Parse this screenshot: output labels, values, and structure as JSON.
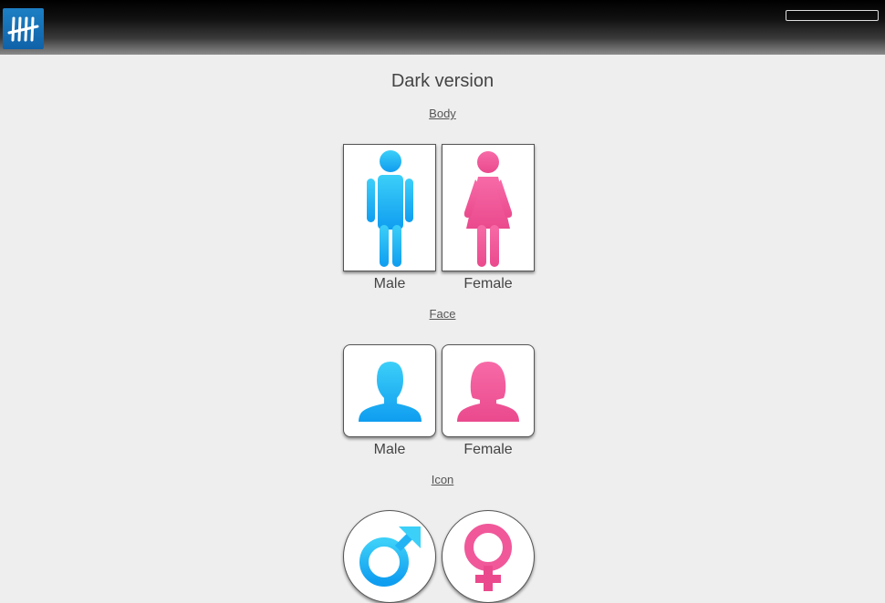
{
  "app": {
    "logo_icon": "tally-marks-icon",
    "brand_color": "#1a75bb",
    "search_value": ""
  },
  "page": {
    "title": "Dark version"
  },
  "sections": {
    "body": {
      "link": "Body",
      "male_label": "Male",
      "female_label": "Female",
      "male_icon": "male-body-icon",
      "female_icon": "female-body-icon"
    },
    "face": {
      "link": "Face",
      "male_label": "Male",
      "female_label": "Female",
      "male_icon": "male-face-icon",
      "female_icon": "female-face-icon"
    },
    "icon": {
      "link": "Icon",
      "male_icon": "mars-symbol-icon",
      "female_icon": "venus-symbol-icon"
    }
  },
  "colors": {
    "male": "#22b3f5",
    "female": "#f0589a"
  }
}
